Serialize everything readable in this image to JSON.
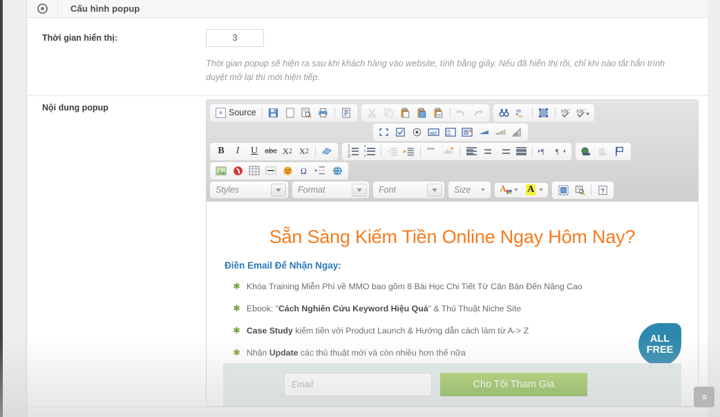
{
  "panel": {
    "header_title": "Cấu hình popup",
    "header_icon": "target-icon"
  },
  "fields": {
    "display_time": {
      "label": "Thời gian hiển thị:",
      "value": "3",
      "help": "Thời gian popup sẽ hiện ra sau khi khách hàng vào website, tính bằng giây. Nếu đã hiển thị rồi, chỉ khi nào tắt hẳn trình duyệt mở lại thì mới hiện tiếp."
    },
    "popup_content": {
      "label": "Nội dung popup"
    }
  },
  "editor": {
    "source_label": "Source",
    "row1_group1": [
      "source-icon",
      "save-icon",
      "new-page-icon",
      "preview-icon",
      "print-icon",
      "templates-icon"
    ],
    "row1_group2": [
      "cut-icon",
      "copy-icon",
      "paste-icon",
      "paste-text-icon",
      "paste-word-icon",
      "undo-icon",
      "redo-icon"
    ],
    "row1_group3": [
      "find-icon",
      "replace-icon",
      "select-all-icon",
      "spellcheck-icon",
      "spellcheck-menu-icon"
    ],
    "row2_group": [
      "form-icon",
      "checkbox-icon",
      "radio-icon",
      "textfield-icon",
      "textarea-icon",
      "selectfield-icon",
      "button-icon",
      "imagebutton-icon",
      "hiddenfield-icon"
    ],
    "row3_group1": [
      "bold-icon",
      "italic-icon",
      "underline-icon",
      "strike-icon",
      "subscript-icon",
      "superscript-icon",
      "remove-format-icon"
    ],
    "row3_group2": [
      "numbered-list-icon",
      "bulleted-list-icon",
      "outdent-icon",
      "indent-icon",
      "blockquote-icon",
      "div-container-icon",
      "align-left-icon",
      "align-center-icon",
      "align-right-icon",
      "justify-icon",
      "ltr-icon",
      "rtl-icon"
    ],
    "row3_group3": [
      "link-icon",
      "unlink-icon",
      "anchor-icon"
    ],
    "row4_group": [
      "image-icon",
      "flash-icon",
      "table-icon",
      "horizontal-rule-icon",
      "smiley-icon",
      "special-char-icon",
      "page-break-icon",
      "iframe-icon"
    ],
    "combos": [
      {
        "name": "styles",
        "label": "Styles"
      },
      {
        "name": "format",
        "label": "Format"
      },
      {
        "name": "font",
        "label": "Font"
      },
      {
        "name": "size",
        "label": "Size"
      }
    ],
    "color_buttons": [
      "text-color-icon",
      "background-color-icon"
    ],
    "last_group": [
      "show-blocks-icon",
      "maximize-icon",
      "about-icon"
    ]
  },
  "content": {
    "headline": "Sẵn Sàng Kiếm Tiền Online Ngay Hôm Nay?",
    "subline": "Điền Email Để Nhận Ngay:",
    "badge_line1": "ALL",
    "badge_line2": "FREE",
    "bullets": [
      {
        "pre": "Khóa Training Miễn Phí về MMO bao gồm 8 Bài Học Chi Tiết Từ Căn Bản Đến Nâng Cao",
        "bold": "",
        "post": ""
      },
      {
        "pre": "Ebook: \"",
        "bold": "Cách Nghiên Cứu Keyword Hiệu Quả",
        "post": "\" & Thủ Thuật Niche Site"
      },
      {
        "pre": "",
        "bold": "Case Study",
        "post": " kiếm tiền với Product Launch & Hướng dẫn cách làm từ A-> Z"
      },
      {
        "pre": "Nhận ",
        "bold": "Update",
        "post": " các thủ thuật mới và còn nhiều hơn thế nữa"
      }
    ],
    "email_placeholder": "Email",
    "submit_label": "Cho Tôi Tham Gia"
  },
  "misc": {
    "scroll_top_icon": "double-chevron-up-icon"
  },
  "colors": {
    "headline_orange": "#F47B20",
    "subline_blue": "#2a79b8",
    "badge_blue": "#2d88ad",
    "button_green": "#79b13b",
    "form_bg": "#e3eaea"
  }
}
